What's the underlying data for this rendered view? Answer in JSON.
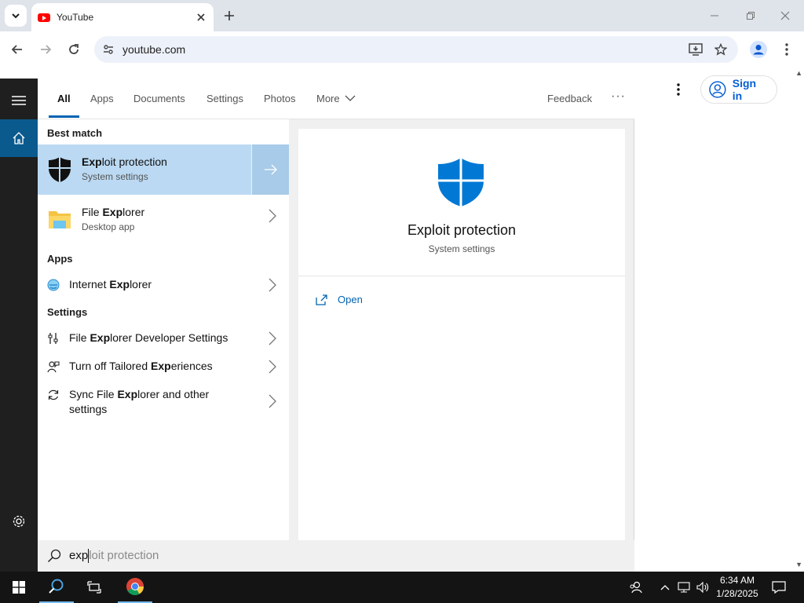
{
  "browser": {
    "tab_title": "YouTube",
    "url": "youtube.com"
  },
  "youtube": {
    "sign_in_label": "Sign in"
  },
  "search": {
    "filters": [
      "All",
      "Apps",
      "Documents",
      "Settings",
      "Photos",
      "More"
    ],
    "feedback_label": "Feedback",
    "best_match_header": "Best match",
    "best_match": {
      "title_bold": "Exp",
      "title_rest": "loit protection",
      "subtitle": "System settings"
    },
    "file_explorer": {
      "title_pre": "File ",
      "title_bold": "Exp",
      "title_rest": "lorer",
      "subtitle": "Desktop app"
    },
    "apps_header": "Apps",
    "apps": [
      {
        "pre": "Internet ",
        "bold": "Exp",
        "rest": "lorer"
      }
    ],
    "settings_header": "Settings",
    "settings": [
      {
        "pre": "File ",
        "bold": "Exp",
        "rest": "lorer Developer Settings"
      },
      {
        "pre": "Turn off Tailored ",
        "bold": "Exp",
        "rest": "eriences"
      },
      {
        "pre": "Sync File ",
        "bold": "Exp",
        "rest": "lorer and other",
        "line2": "settings"
      }
    ],
    "preview": {
      "title": "Exploit protection",
      "subtitle": "System settings",
      "open_label": "Open"
    },
    "query_typed": "exp",
    "query_suggestion": "loit protection"
  },
  "taskbar": {
    "time": "6:34 AM",
    "date": "1/28/2025"
  },
  "colors": {
    "accent": "#0063b1",
    "best_match_bg": "#bbd9f2",
    "defender_blue": "#0078d4"
  }
}
